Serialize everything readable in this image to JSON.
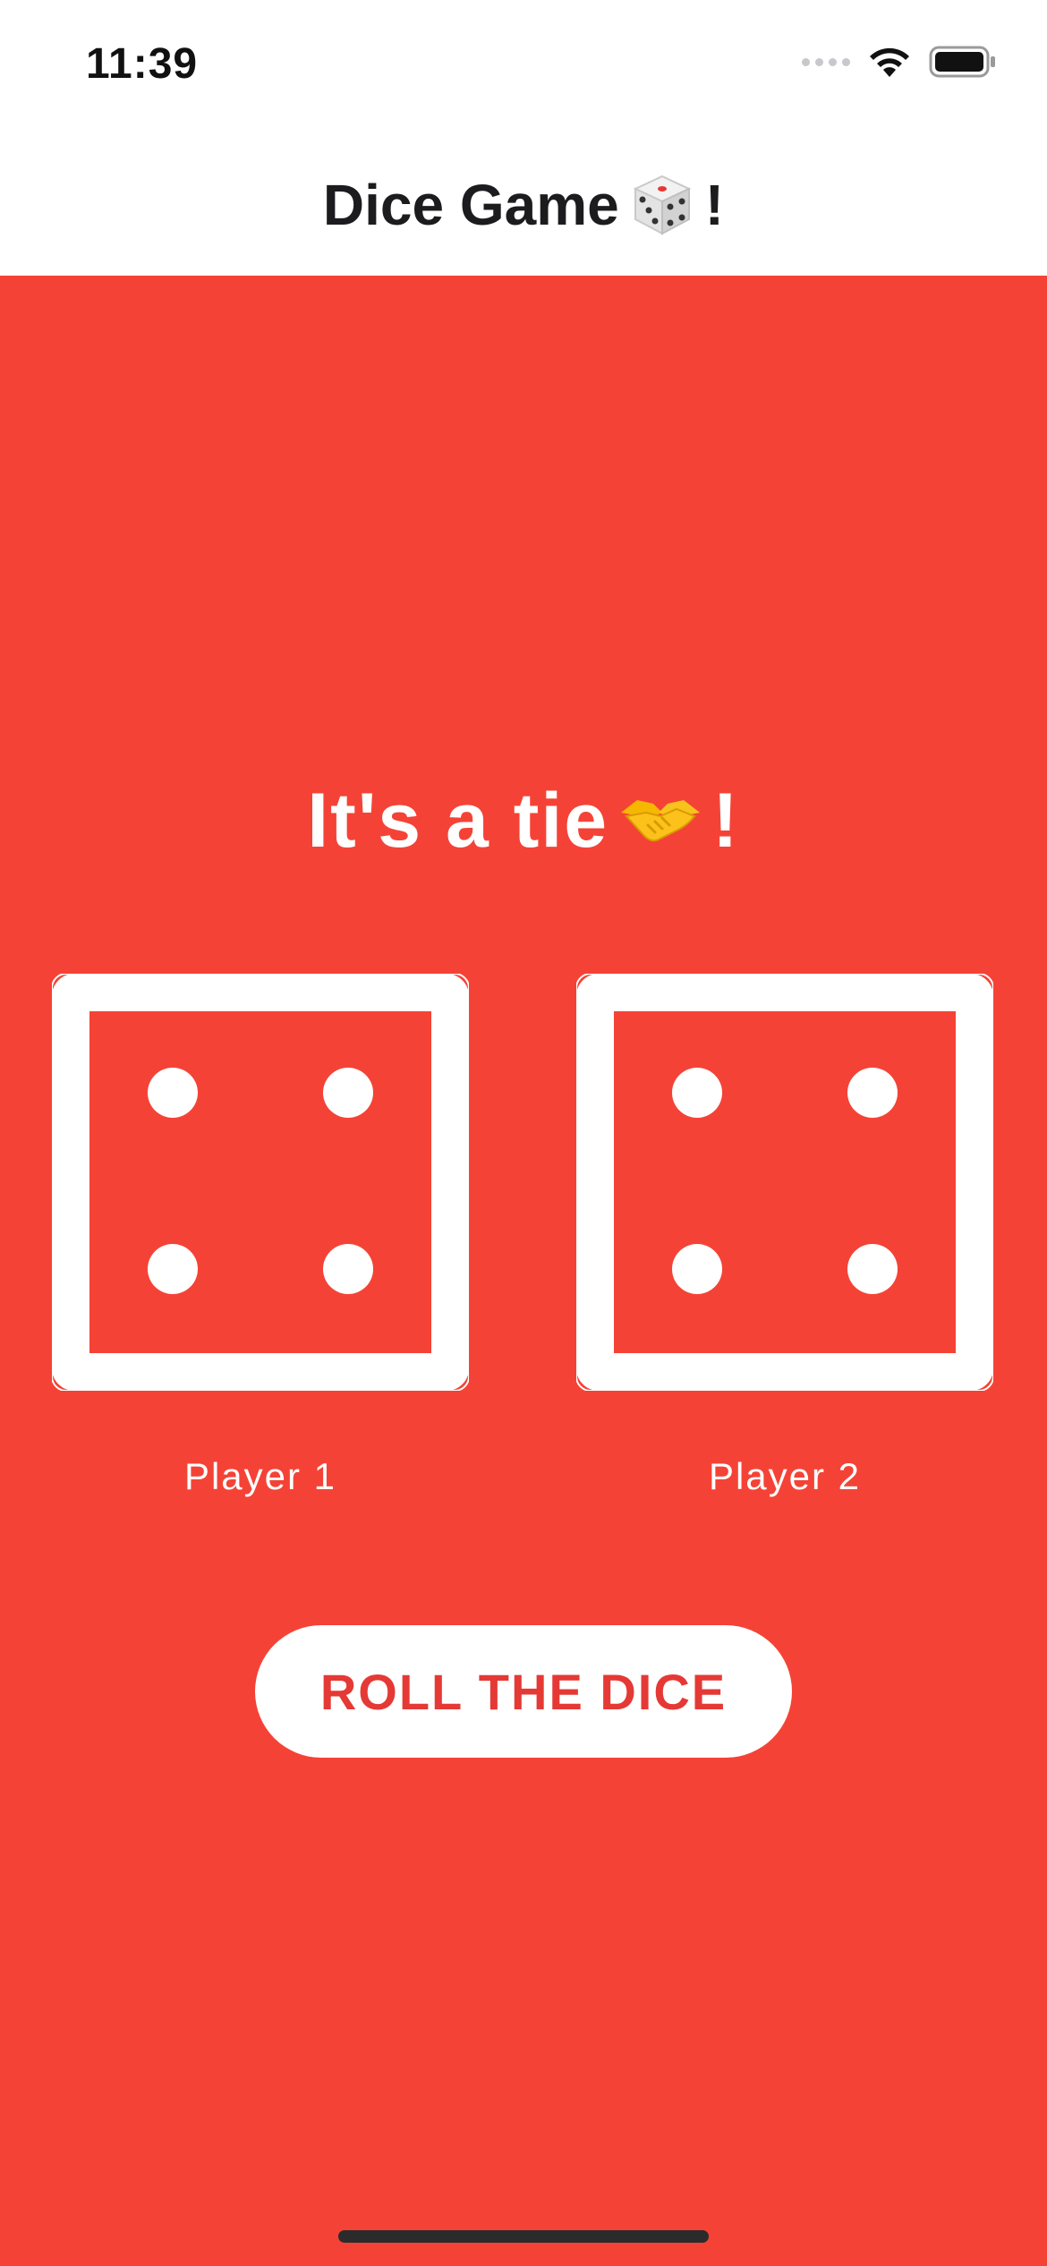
{
  "status_bar": {
    "time": "11:39"
  },
  "nav": {
    "title": "Dice Game",
    "title_suffix": "!"
  },
  "game": {
    "result_text": "It's a tie",
    "result_suffix": "!",
    "player1": {
      "label": "Player 1",
      "die_value": 4
    },
    "player2": {
      "label": "Player 2",
      "die_value": 4
    },
    "roll_button_label": "ROLL THE DICE"
  },
  "icons": {
    "title_icon": "game-die-icon",
    "result_icon": "handshake-icon"
  },
  "colors": {
    "background_red": "#f44336",
    "button_text": "#e53935",
    "white": "#ffffff"
  }
}
